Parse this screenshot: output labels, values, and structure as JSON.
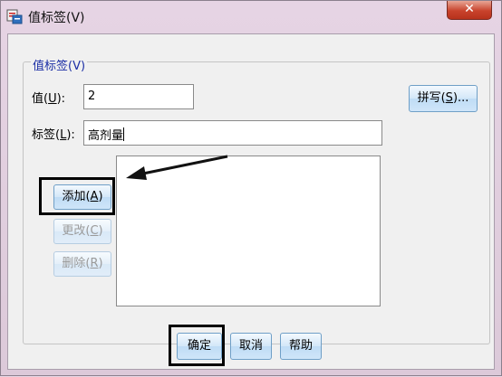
{
  "window": {
    "title": "值标签(V)",
    "close_glyph": "✕"
  },
  "group": {
    "legend": "值标签(V)"
  },
  "value": {
    "label_prefix": "值(",
    "label_key": "U",
    "label_suffix": "):",
    "input": "2"
  },
  "label": {
    "label_prefix": "标签(",
    "label_key": "L",
    "label_suffix": "):",
    "input": "高剂量"
  },
  "buttons": {
    "spelling": {
      "prefix": "拼写(",
      "key": "S",
      "suffix": ")..."
    },
    "add": {
      "prefix": "添加(",
      "key": "A",
      "suffix": ")"
    },
    "change": {
      "prefix": "更改(",
      "key": "C",
      "suffix": ")"
    },
    "remove": {
      "prefix": "删除(",
      "key": "R",
      "suffix": ")"
    },
    "ok": "确定",
    "cancel": "取消",
    "help": "帮助"
  },
  "value_labels_list": [],
  "colors": {
    "legend": "#1b2ea5",
    "close": "#c8432c",
    "button_border": "#6f9fc7"
  }
}
